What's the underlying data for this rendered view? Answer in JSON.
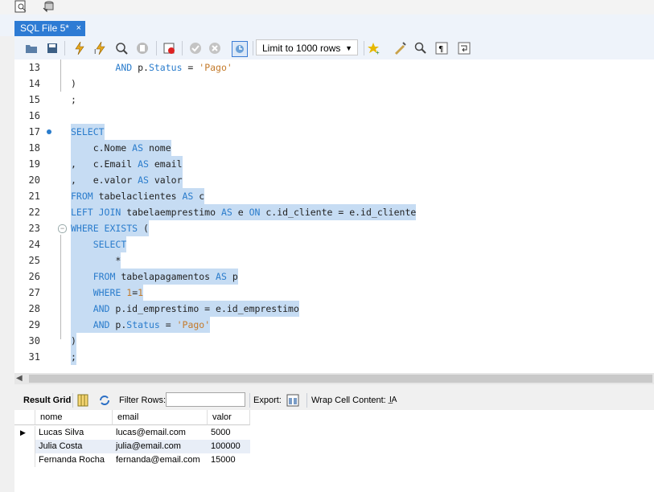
{
  "tab": {
    "title": "SQL File 5*",
    "close": "×"
  },
  "toolbar": {
    "limit_label": "Limit to 1000 rows",
    "icons": [
      "open-folder-icon",
      "save-icon",
      "execute-icon",
      "execute-current-icon",
      "explain-icon",
      "stop-icon",
      "toggle-error-icon",
      "commit-icon",
      "rollback-icon",
      "autocommit-icon",
      "add-snippet-icon",
      "beautify-icon",
      "find-icon",
      "invisible-chars-icon",
      "wrap-icon"
    ]
  },
  "editor": {
    "lines": [
      {
        "n": "13",
        "code": [
          {
            "t": "        "
          },
          {
            "t": "AND",
            "c": "kw"
          },
          {
            "t": " p."
          },
          {
            "t": "Status",
            "c": "kw"
          },
          {
            "t": " = "
          },
          {
            "t": "'Pago'",
            "c": "str"
          }
        ]
      },
      {
        "n": "14",
        "code": [
          {
            "t": ")"
          }
        ]
      },
      {
        "n": "15",
        "code": [
          {
            "t": ";"
          }
        ]
      },
      {
        "n": "16",
        "code": []
      },
      {
        "n": "17",
        "code": [
          {
            "t": "SELECT",
            "c": "kw"
          }
        ],
        "sel": true,
        "bp": true
      },
      {
        "n": "18",
        "code": [
          {
            "t": "    c.Nome "
          },
          {
            "t": "AS",
            "c": "kw"
          },
          {
            "t": " nome"
          }
        ],
        "sel": true
      },
      {
        "n": "19",
        "code": [
          {
            "t": ",   c.Email "
          },
          {
            "t": "AS",
            "c": "kw"
          },
          {
            "t": " email"
          }
        ],
        "sel": true
      },
      {
        "n": "20",
        "code": [
          {
            "t": ",   e.valor "
          },
          {
            "t": "AS",
            "c": "kw"
          },
          {
            "t": " valor"
          }
        ],
        "sel": true
      },
      {
        "n": "21",
        "code": [
          {
            "t": "FROM",
            "c": "kw"
          },
          {
            "t": " tabelaclientes "
          },
          {
            "t": "AS",
            "c": "kw"
          },
          {
            "t": " c"
          }
        ],
        "sel": true
      },
      {
        "n": "22",
        "code": [
          {
            "t": "LEFT JOIN",
            "c": "kw"
          },
          {
            "t": " tabelaemprestimo "
          },
          {
            "t": "AS",
            "c": "kw"
          },
          {
            "t": " e "
          },
          {
            "t": "ON",
            "c": "kw"
          },
          {
            "t": " c.id_cliente = e.id_cliente"
          }
        ],
        "sel": true
      },
      {
        "n": "23",
        "code": [
          {
            "t": "WHERE EXISTS",
            "c": "kw"
          },
          {
            "t": " ("
          }
        ],
        "sel": true,
        "fold": true
      },
      {
        "n": "24",
        "code": [
          {
            "t": "    "
          },
          {
            "t": "SELECT",
            "c": "kw"
          }
        ],
        "sel": true
      },
      {
        "n": "25",
        "code": [
          {
            "t": "        *"
          }
        ],
        "sel": true
      },
      {
        "n": "26",
        "code": [
          {
            "t": "    "
          },
          {
            "t": "FROM",
            "c": "kw"
          },
          {
            "t": " tabelapagamentos "
          },
          {
            "t": "AS",
            "c": "kw"
          },
          {
            "t": " p"
          }
        ],
        "sel": true
      },
      {
        "n": "27",
        "code": [
          {
            "t": "    "
          },
          {
            "t": "WHERE",
            "c": "kw"
          },
          {
            "t": " "
          },
          {
            "t": "1",
            "c": "num"
          },
          {
            "t": "="
          },
          {
            "t": "1",
            "c": "num"
          }
        ],
        "sel": true
      },
      {
        "n": "28",
        "code": [
          {
            "t": "    "
          },
          {
            "t": "AND",
            "c": "kw"
          },
          {
            "t": " p.id_emprestimo = e.id_emprestimo"
          }
        ],
        "sel": true
      },
      {
        "n": "29",
        "code": [
          {
            "t": "    "
          },
          {
            "t": "AND",
            "c": "kw"
          },
          {
            "t": " p."
          },
          {
            "t": "Status",
            "c": "kw"
          },
          {
            "t": " = "
          },
          {
            "t": "'Pago'",
            "c": "str"
          }
        ],
        "sel": true
      },
      {
        "n": "30",
        "code": [
          {
            "t": ")"
          }
        ],
        "sel": true
      },
      {
        "n": "31",
        "code": [
          {
            "t": ";"
          }
        ],
        "sel": true
      }
    ]
  },
  "results": {
    "result_grid_label": "Result Grid",
    "filter_label": "Filter Rows:",
    "export_label": "Export:",
    "wrap_label": "Wrap Cell Content:",
    "wrap_icon_text": "I̲A",
    "columns": [
      "nome",
      "email",
      "valor"
    ],
    "rows": [
      [
        "Lucas Silva",
        "lucas@email.com",
        "5000"
      ],
      [
        "Julia Costa",
        "julia@email.com",
        "100000"
      ],
      [
        "Fernanda Rocha",
        "fernanda@email.com",
        "15000"
      ]
    ]
  },
  "colors": {
    "tab_active": "#2d7bd4",
    "keyword": "#2a7ccc",
    "string": "#c47a2a",
    "selection": "#c6dcf3"
  }
}
